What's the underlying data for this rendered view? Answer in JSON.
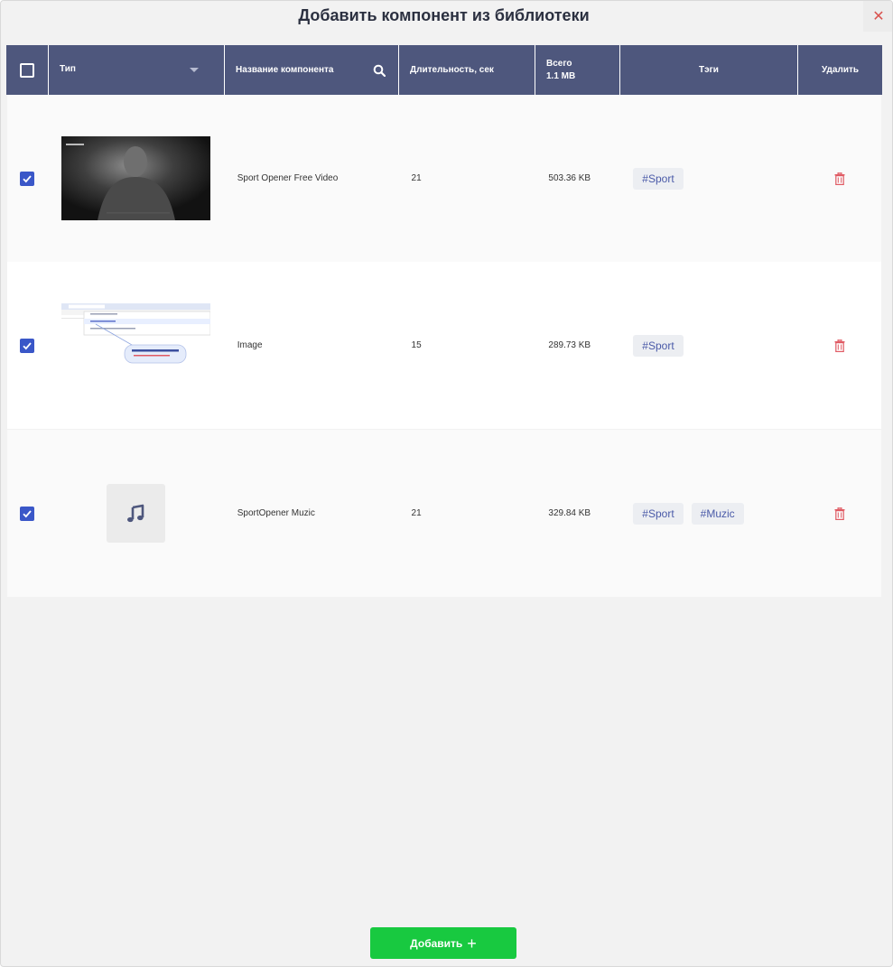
{
  "dialog": {
    "title": "Добавить компонент из библиотеки",
    "close_glyph": "✕"
  },
  "table": {
    "columns": {
      "type": "Тип",
      "name": "Название компонента",
      "duration": "Длительность, сек",
      "total_label": "Всего",
      "total_value": "1.1 MB",
      "tags": "Тэги",
      "delete": "Удалить"
    },
    "rows": [
      {
        "checked": true,
        "media": "video-thumbnail",
        "name": "Sport Opener Free Video",
        "duration": "21",
        "size": "503.36 KB",
        "tags": [
          "#Sport"
        ]
      },
      {
        "checked": true,
        "media": "image-thumbnail",
        "name": "Image",
        "duration": "15",
        "size": "289.73 KB",
        "tags": [
          "#Sport"
        ]
      },
      {
        "checked": true,
        "media": "music-icon",
        "name": "SportOpener Muzic",
        "duration": "21",
        "size": "329.84 KB",
        "tags": [
          "#Sport",
          "#Muzic"
        ]
      }
    ]
  },
  "footer": {
    "add_label": "Добавить",
    "add_glyph": "+"
  },
  "colors": {
    "header_bg": "#4e577d",
    "checkbox": "#3a57c8",
    "add_button": "#18c940",
    "trash": "#e05a63",
    "tag_text": "#4a5aa8"
  }
}
